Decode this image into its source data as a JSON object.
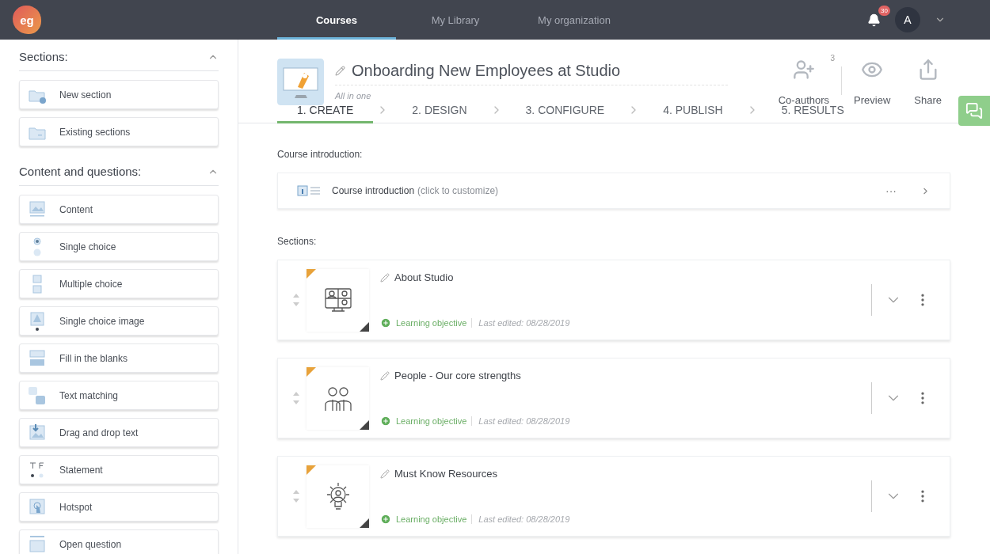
{
  "topbar": {
    "logo": "eg",
    "nav": [
      {
        "label": "Courses",
        "selected": true
      },
      {
        "label": "My Library",
        "selected": false
      },
      {
        "label": "My organization",
        "selected": false
      }
    ],
    "notifications": "30",
    "avatar": "A"
  },
  "sidebar": {
    "groups": [
      {
        "title": "Sections:",
        "expanded": true,
        "items": [
          {
            "kind": "new-folder",
            "label": "New section"
          },
          {
            "kind": "folder",
            "label": "Existing sections"
          }
        ]
      },
      {
        "title": "Content and questions:",
        "expanded": true,
        "items": [
          {
            "kind": "content",
            "label": "Content"
          },
          {
            "kind": "radio",
            "label": "Single choice"
          },
          {
            "kind": "checkbox",
            "label": "Multiple choice"
          },
          {
            "kind": "image-choice",
            "label": "Single choice image"
          },
          {
            "kind": "blanks",
            "label": "Fill in the blanks"
          },
          {
            "kind": "puzzle",
            "label": "Text matching"
          },
          {
            "kind": "drag",
            "label": "Drag and drop text"
          },
          {
            "kind": "statement",
            "label": "Statement"
          },
          {
            "kind": "hotspot",
            "label": "Hotspot"
          },
          {
            "kind": "open",
            "label": "Open question"
          }
        ]
      }
    ]
  },
  "course": {
    "title": "Onboarding New Employees at Studio",
    "subtitle": "All in one",
    "actions": [
      {
        "kind": "coauthors",
        "label": "Co-authors",
        "count": "3"
      },
      {
        "kind": "preview",
        "label": "Preview"
      },
      {
        "kind": "share",
        "label": "Share"
      }
    ]
  },
  "steps": [
    {
      "label": "1. CREATE",
      "selected": true
    },
    {
      "label": "2. DESIGN",
      "selected": false
    },
    {
      "label": "3. CONFIGURE",
      "selected": false
    },
    {
      "label": "4. PUBLISH",
      "selected": false
    },
    {
      "label": "5. RESULTS",
      "selected": false
    }
  ],
  "introduction": {
    "heading": "Course introduction:",
    "title": "Course introduction",
    "hint": "(click to customize)",
    "menu": "···"
  },
  "sections": {
    "heading": "Sections:",
    "items": [
      {
        "kind": "video-call",
        "title": "About Studio",
        "objective": "Learning objective",
        "edited": "Last edited: 08/28/2019"
      },
      {
        "kind": "people",
        "title": "People - Our core strengths",
        "objective": "Learning objective",
        "edited": "Last edited: 08/28/2019"
      },
      {
        "kind": "lightbulb",
        "title": "Must Know Resources",
        "objective": "Learning objective",
        "edited": "Last edited: 08/28/2019"
      }
    ]
  }
}
